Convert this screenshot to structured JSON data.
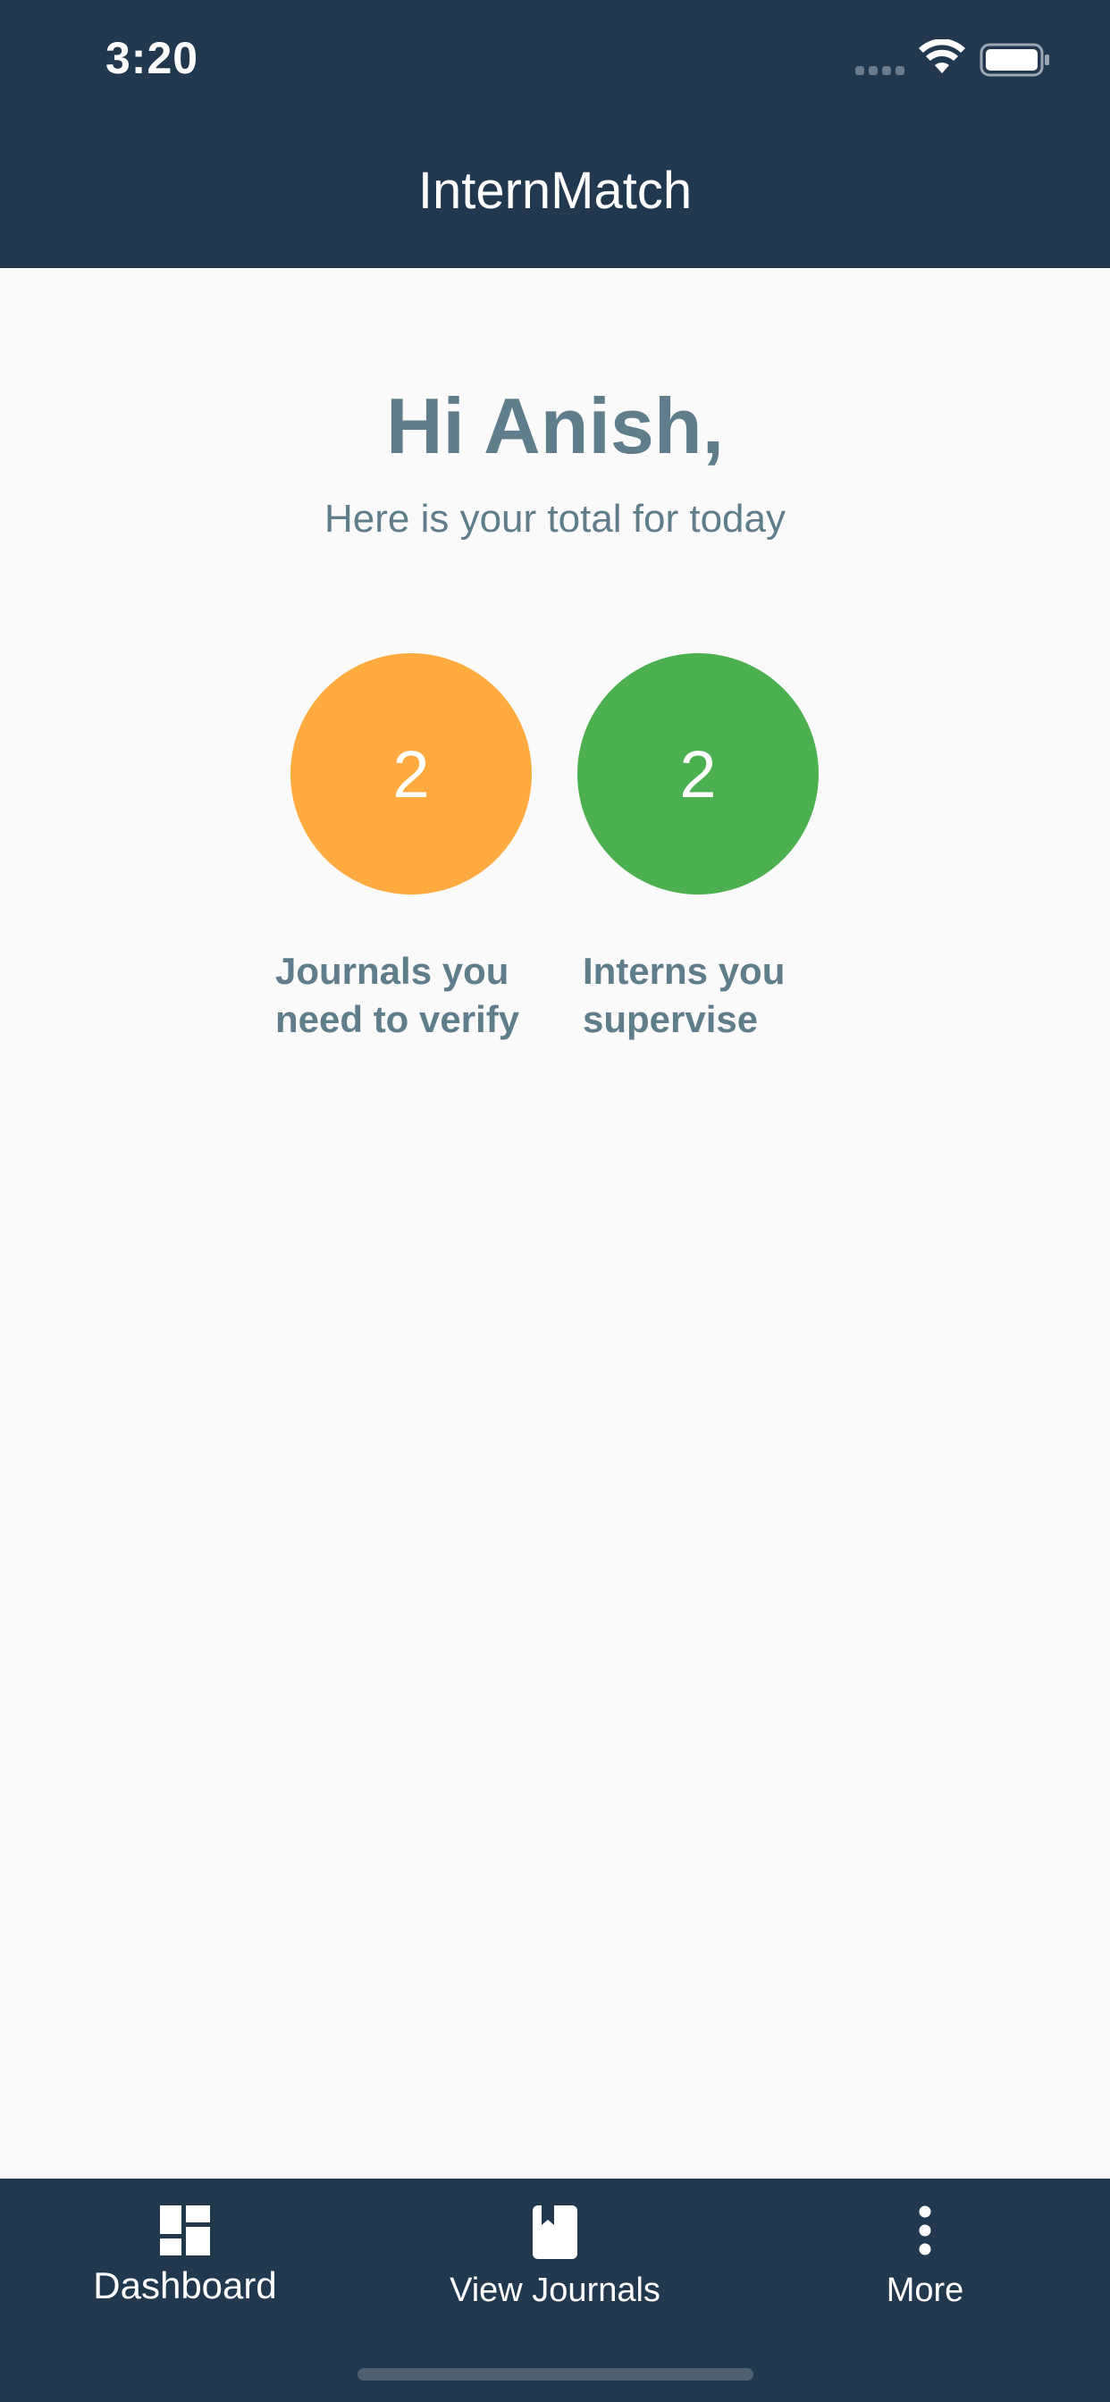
{
  "status_bar": {
    "time": "3:20",
    "icons": [
      "cellular-signal-icon",
      "wifi-icon",
      "battery-icon"
    ]
  },
  "header": {
    "title": "InternMatch"
  },
  "main": {
    "greeting": "Hi Anish,",
    "subtitle": "Here is your total for today",
    "stats": [
      {
        "value": "2",
        "label": "Journals you\nneed to verify",
        "color": "#ffab40"
      },
      {
        "value": "2",
        "label": "Interns you\nsupervise",
        "color": "#4caf50"
      }
    ]
  },
  "bottom_nav": {
    "items": [
      {
        "label": "Dashboard",
        "icon": "dashboard-icon"
      },
      {
        "label": "View Journals",
        "icon": "journal-icon"
      },
      {
        "label": "More",
        "icon": "more-vertical-icon"
      }
    ]
  },
  "colors": {
    "header_bg": "#22384e",
    "text_muted": "#607d8b",
    "page_bg": "#fafafa"
  }
}
